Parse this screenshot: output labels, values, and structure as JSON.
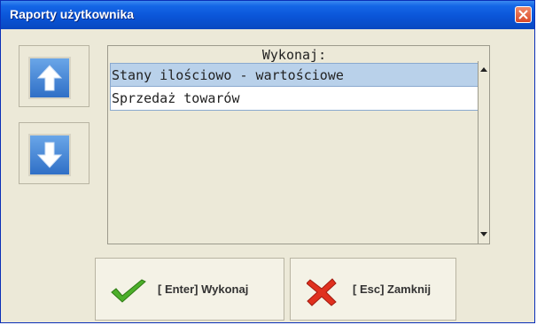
{
  "window": {
    "title": "Raporty użytkownika"
  },
  "list": {
    "header": "Wykonaj:",
    "items": [
      {
        "label": "Stany ilościowo - wartościowe",
        "selected": true
      },
      {
        "label": "Sprzedaż towarów",
        "selected": false
      }
    ]
  },
  "side_buttons": {
    "up_icon": "arrow-up-icon",
    "down_icon": "arrow-down-icon"
  },
  "actions": {
    "execute_label": "[ Enter] Wykonaj",
    "close_label": "[ Esc] Zamknij"
  },
  "colors": {
    "titlebar": "#0a55d8",
    "selected_row": "#b9d1ea",
    "check_green": "#4caf2a",
    "cross_red": "#e0301e"
  }
}
